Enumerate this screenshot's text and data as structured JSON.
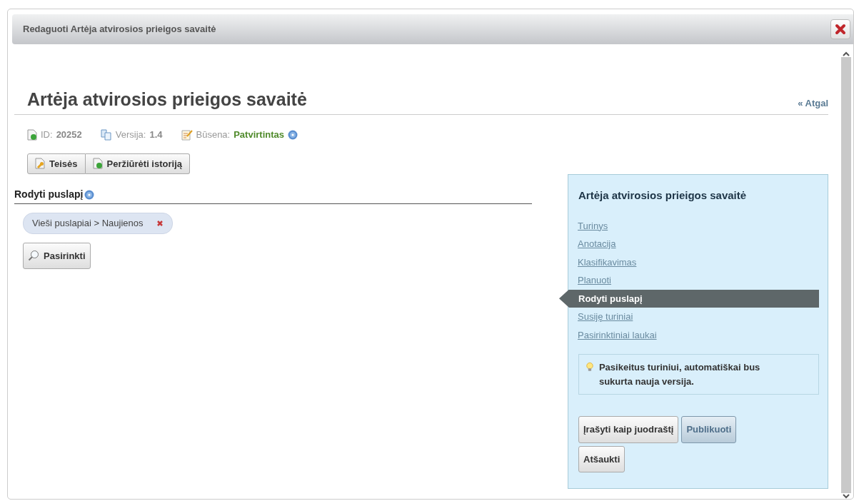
{
  "window": {
    "title": "Redaguoti Artėja atvirosios prieigos savaitė"
  },
  "page": {
    "title": "Artėja atvirosios prieigos savaitė",
    "back_link": "« Atgal"
  },
  "meta": [
    {
      "kind": "id",
      "label": "ID:",
      "value": "20252"
    },
    {
      "kind": "version",
      "label": "Versija:",
      "value": "1.4"
    },
    {
      "kind": "status",
      "label": "Būsena:",
      "value": "Patvirtintas"
    }
  ],
  "toolbar": [
    {
      "kind": "rights",
      "label": "Teisės"
    },
    {
      "kind": "history",
      "label": "Peržiūrėti istoriją"
    }
  ],
  "section": {
    "title": "Rodyti puslapį",
    "tags": [
      "Vieši puslapiai > Naujienos"
    ],
    "choose_button": "Pasirinkti"
  },
  "side_panel": {
    "title": "Artėja atvirosios prieigos savaitė",
    "items": [
      {
        "label": "Turinys",
        "selected": false
      },
      {
        "label": "Anotacija",
        "selected": false
      },
      {
        "label": "Klasifikavimas",
        "selected": false
      },
      {
        "label": "Planuoti",
        "selected": false
      },
      {
        "label": "Rodyti puslapį",
        "selected": true
      },
      {
        "label": "Susiję turiniai",
        "selected": false
      },
      {
        "label": "Pasirinktiniai laukai",
        "selected": false
      }
    ],
    "note": "Pasikeitus turiniui, automatiškai bus sukurta nauja versija.",
    "buttons": [
      {
        "kind": "default",
        "label": "Įrašyti kaip juodraštį"
      },
      {
        "kind": "primary",
        "label": "Publikuoti"
      },
      {
        "kind": "default",
        "label": "Atšaukti"
      }
    ]
  }
}
